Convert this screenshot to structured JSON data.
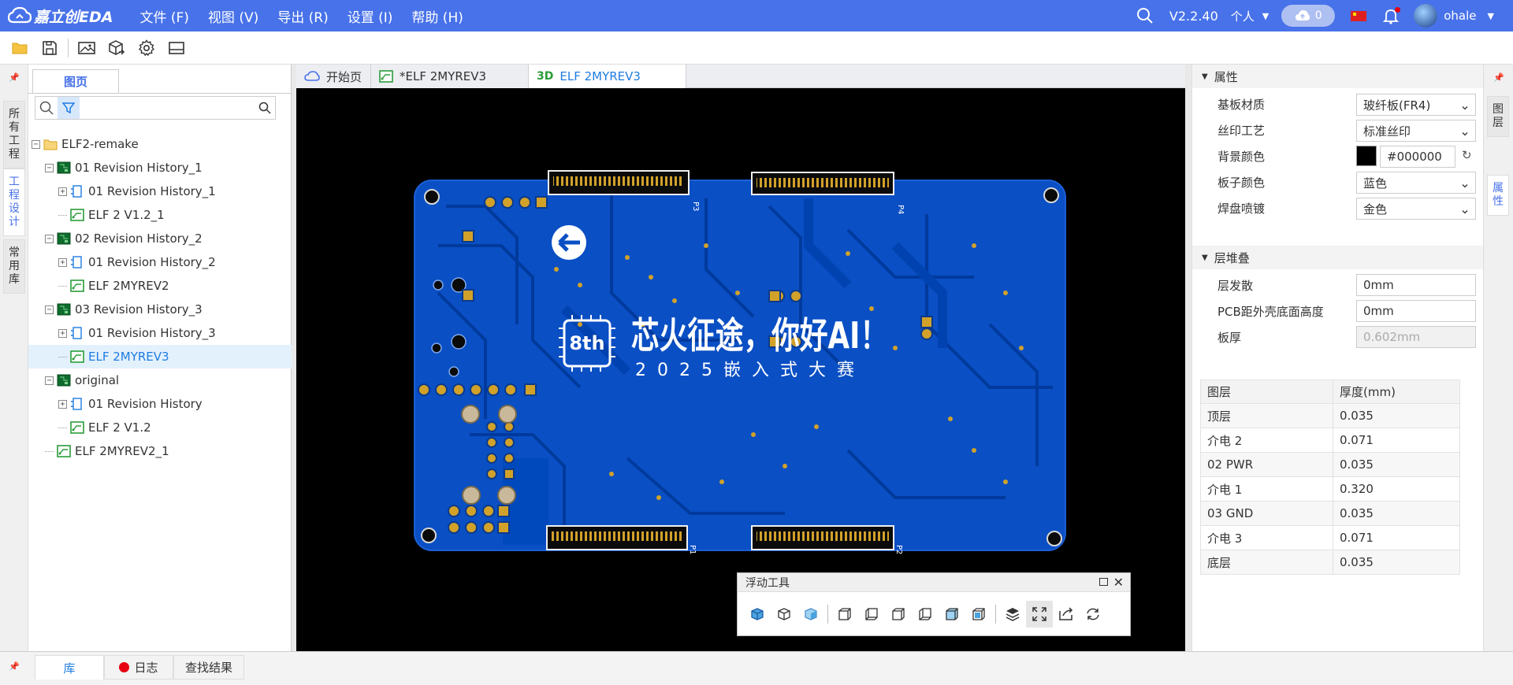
{
  "app": {
    "logo_text": "嘉立创EDA"
  },
  "menu": [
    "文件 (F)",
    "视图 (V)",
    "导出 (R)",
    "设置 (I)",
    "帮助 (H)"
  ],
  "header_right": {
    "version": "V2.2.40",
    "mode": "个人",
    "cloud_count": "0",
    "username": "ohale"
  },
  "left_rail": {
    "tab_all_projects": "所有工程",
    "tab_project_design": "工程设计",
    "tab_common_lib": "常用库"
  },
  "left_panel": {
    "tab_label": "图页",
    "search_value": "",
    "tree": [
      {
        "label": "ELF2-remake",
        "level": 0,
        "icon": "folder-icon",
        "expander": "−"
      },
      {
        "label": "01 Revision History_1",
        "level": 1,
        "icon": "board-icon",
        "expander": "−"
      },
      {
        "label": "01 Revision History_1",
        "level": 2,
        "icon": "schematic-icon",
        "expander": "+"
      },
      {
        "label": "ELF 2 V1.2_1",
        "level": 2,
        "icon": "pcb-icon",
        "expander": ""
      },
      {
        "label": "02 Revision History_2",
        "level": 1,
        "icon": "board-icon",
        "expander": "−"
      },
      {
        "label": "01 Revision History_2",
        "level": 2,
        "icon": "schematic-icon",
        "expander": "+"
      },
      {
        "label": "ELF 2MYREV2",
        "level": 2,
        "icon": "pcb-icon",
        "expander": ""
      },
      {
        "label": "03 Revision History_3",
        "level": 1,
        "icon": "board-icon",
        "expander": "−"
      },
      {
        "label": "01 Revision History_3",
        "level": 2,
        "icon": "schematic-icon",
        "expander": "+"
      },
      {
        "label": "ELF 2MYREV3",
        "level": 2,
        "icon": "pcb-icon",
        "expander": "",
        "selected": true
      },
      {
        "label": "original",
        "level": 1,
        "icon": "board-icon",
        "expander": "−"
      },
      {
        "label": "01 Revision History",
        "level": 2,
        "icon": "schematic-icon",
        "expander": "+"
      },
      {
        "label": "ELF 2 V1.2",
        "level": 2,
        "icon": "pcb-icon",
        "expander": ""
      },
      {
        "label": "ELF 2MYREV2_1",
        "level": 1,
        "icon": "pcb-icon",
        "expander": ""
      }
    ]
  },
  "editor_tabs": [
    {
      "label": "开始页",
      "icon": "cloud-icon",
      "active": false
    },
    {
      "label": "*ELF 2MYREV3",
      "icon": "pcb-icon",
      "active": false
    },
    {
      "label": "ELF 2MYREV3",
      "icon": "3d-icon",
      "icon_text": "3D",
      "active": true
    }
  ],
  "pcb": {
    "banner_title": "芯火征途，你好AI！",
    "banner_subtitle": "2025嵌入式大赛",
    "logo_text": "8th",
    "connector_labels": [
      "P3",
      "P4",
      "P1",
      "P2"
    ],
    "board_color": "#0a4fc4",
    "trace_color": "#003a9c",
    "pad_color": "#d1a12a"
  },
  "float_tools": {
    "title": "浮动工具"
  },
  "properties": {
    "section_title": "属性",
    "rows": [
      {
        "label": "基板材质",
        "value": "玻纤板(FR4)",
        "type": "select"
      },
      {
        "label": "丝印工艺",
        "value": "标准丝印",
        "type": "select"
      },
      {
        "label": "背景颜色",
        "value": "#000000",
        "type": "color",
        "swatch": "#000000"
      },
      {
        "label": "板子颜色",
        "value": "蓝色",
        "type": "select"
      },
      {
        "label": "焊盘喷镀",
        "value": "金色",
        "type": "select"
      }
    ]
  },
  "stackup": {
    "section_title": "层堆叠",
    "rows": [
      {
        "label": "层发散",
        "value": "0mm",
        "disabled": false
      },
      {
        "label": "PCB距外壳底面高度",
        "value": "0mm",
        "disabled": false
      },
      {
        "label": "板厚",
        "value": "0.602mm",
        "disabled": true
      }
    ],
    "table_headers": [
      "图层",
      "厚度(mm)"
    ],
    "table_rows": [
      [
        "顶层",
        "0.035"
      ],
      [
        "介电 2",
        "0.071"
      ],
      [
        "02 PWR",
        "0.035"
      ],
      [
        "介电 1",
        "0.320"
      ],
      [
        "03 GND",
        "0.035"
      ],
      [
        "介电 3",
        "0.071"
      ],
      [
        "底层",
        "0.035"
      ]
    ]
  },
  "right_rail": {
    "tab_layers": "图层",
    "tab_props": "属性"
  },
  "bottom_tabs": [
    "库",
    "日志",
    "查找结果"
  ],
  "colors": {
    "brand": "#4872e9",
    "accent": "#1e7ce0",
    "canvas_bg": "#000000",
    "log_dot": "#e60012"
  }
}
